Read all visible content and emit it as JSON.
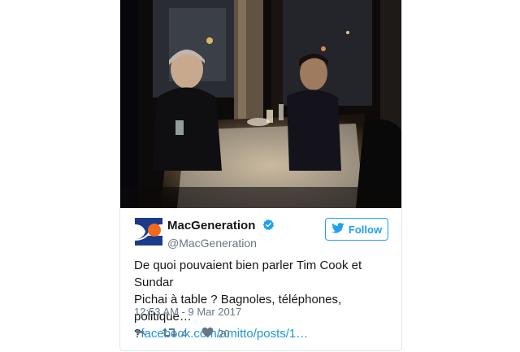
{
  "tweet": {
    "display_name": "MacGeneration",
    "handle": "@MacGeneration",
    "follow_label": "Follow",
    "text_line1": "De quoi pouvaient bien parler Tim Cook et Sundar",
    "text_line2": "Pichai à table ? Bagnoles, téléphones, politique…",
    "text_line3_prefix": "?",
    "link_text": "facebook.com/amitto/posts/1…",
    "timestamp": "12:53 AM - 9 Mar 2017",
    "retweet_count": "4",
    "like_count": "20"
  },
  "icons": {
    "avatar": "macgeneration-logo",
    "verified": "verified-badge-icon",
    "follow": "twitter-bird-icon",
    "reply": "reply-icon",
    "retweet": "retweet-icon",
    "like": "heart-icon"
  },
  "colors": {
    "accent": "#1da1f2",
    "link": "#1b95e0",
    "secondary_text": "#657786",
    "logo_blue": "#1b3a8c",
    "logo_orange": "#f26a1b"
  }
}
